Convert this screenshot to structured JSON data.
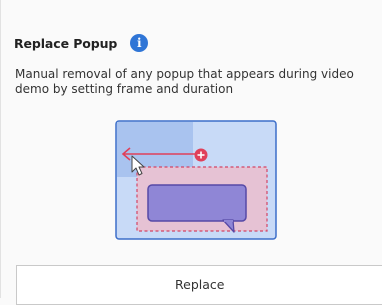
{
  "panel": {
    "title": "Replace Popup",
    "info_icon": "info-icon",
    "description": "Manual removal of any popup that appears during video demo by setting frame and duration",
    "replace_label": "Replace"
  },
  "illustration": {
    "icon": "replace-popup-illustration",
    "colors": {
      "frame_border": "#3c6ec9",
      "frame_fill": "#c8daf7",
      "selection_fill": "#e6c2d4",
      "selection_border": "#d24666",
      "popup_fill": "#8f86d6",
      "popup_border": "#5649a6",
      "arrow": "#e0405a",
      "accent": "#2f75d6"
    }
  }
}
